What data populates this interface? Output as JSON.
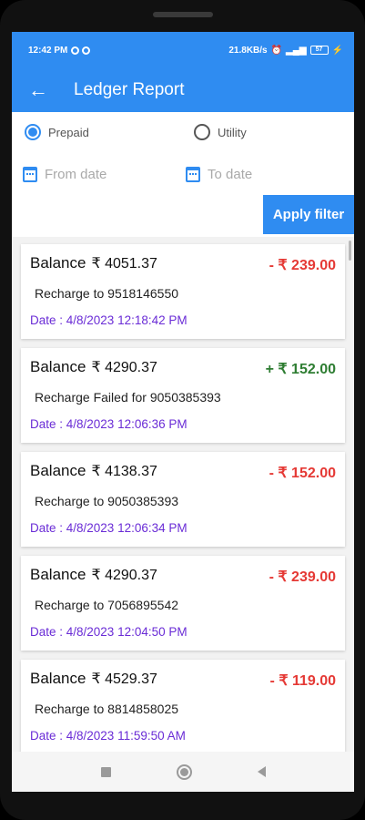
{
  "status_bar": {
    "time": "12:42 PM",
    "speed": "21.8KB/s",
    "battery": "57"
  },
  "app_bar": {
    "back_icon": "arrow-left-icon",
    "title": "Ledger Report"
  },
  "filters": {
    "radio_options": [
      {
        "label": "Prepaid",
        "selected": true
      },
      {
        "label": "Utility",
        "selected": false
      }
    ],
    "from_date_placeholder": "From date",
    "to_date_placeholder": "To date",
    "apply_label": "Apply filter"
  },
  "colors": {
    "primary": "#2f8cf1",
    "debit": "#e53935",
    "credit": "#2e7d32",
    "date_text": "#6a2cd6"
  },
  "ledger": [
    {
      "balance_label": "Balance",
      "balance": "₹ 4051.37",
      "amount": "- ₹ 239.00",
      "type": "debit",
      "description": "Recharge to 9518146550",
      "date": "Date : 4/8/2023 12:18:42 PM"
    },
    {
      "balance_label": "Balance",
      "balance": "₹ 4290.37",
      "amount": "+ ₹ 152.00",
      "type": "credit",
      "description": "Recharge Failed for 9050385393",
      "date": "Date : 4/8/2023 12:06:36 PM"
    },
    {
      "balance_label": "Balance",
      "balance": "₹ 4138.37",
      "amount": "- ₹ 152.00",
      "type": "debit",
      "description": "Recharge to 9050385393",
      "date": "Date : 4/8/2023 12:06:34 PM"
    },
    {
      "balance_label": "Balance",
      "balance": "₹ 4290.37",
      "amount": "- ₹ 239.00",
      "type": "debit",
      "description": "Recharge to 7056895542",
      "date": "Date : 4/8/2023 12:04:50 PM"
    },
    {
      "balance_label": "Balance",
      "balance": "₹ 4529.37",
      "amount": "- ₹ 119.00",
      "type": "debit",
      "description": "Recharge to 8814858025",
      "date": "Date : 4/8/2023 11:59:50 AM"
    }
  ]
}
